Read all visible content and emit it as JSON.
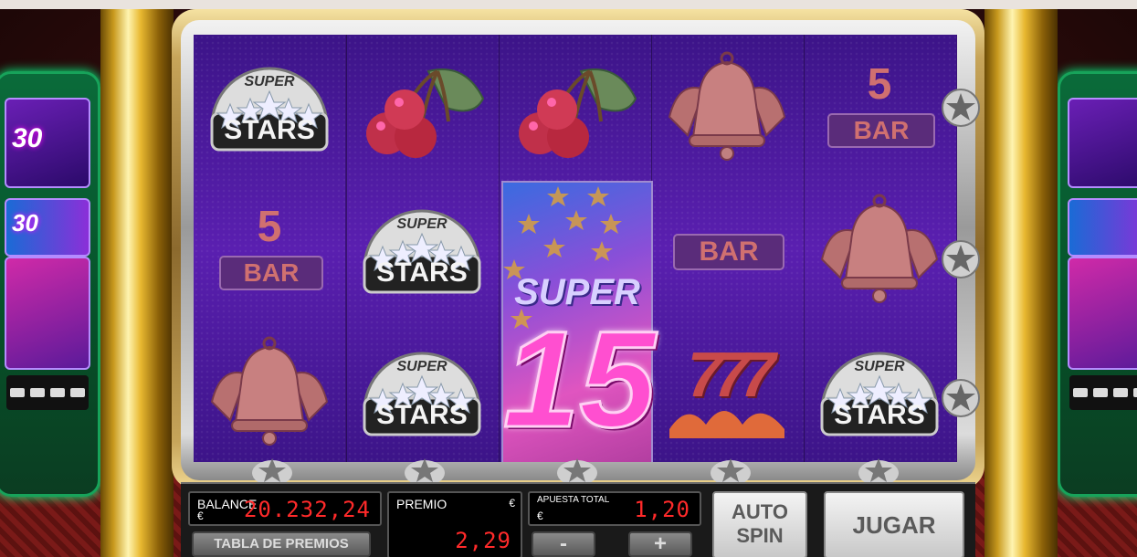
{
  "panel": {
    "balance_label": "BALANCE",
    "balance_currency": "€",
    "balance_value": "20.232,24",
    "prize_label": "PREMIO",
    "prize_currency": "€",
    "prize_value": "2,29",
    "bet_label": "APUESTA TOTAL",
    "bet_currency": "€",
    "bet_value": "1,20",
    "paytable_label": "TABLA DE PREMIOS",
    "minus_label": "-",
    "plus_label": "+",
    "autospin_line1": "AUTO",
    "autospin_line2": "SPIN",
    "play_label": "JUGAR"
  },
  "reels": [
    [
      "super-stars",
      "5-bar",
      "bell"
    ],
    [
      "cherries",
      "super-stars",
      "super-stars"
    ],
    [
      "cherries",
      "super-15-expanded",
      "super-15-expanded"
    ],
    [
      "bell",
      "bar",
      "sevens"
    ],
    [
      "5-bar",
      "bell",
      "super-stars"
    ]
  ],
  "symbol_text": {
    "super_stars_top": "SUPER",
    "super_stars_bottom": "STARS",
    "five_bar_number": "5",
    "bar_word": "BAR",
    "seven": "777",
    "super15_word": "SUPER",
    "super15_number": "15"
  },
  "colors": {
    "reel_bg": "#4a1a9a",
    "lcd_digits": "#ff2a2a",
    "gold": "#e8b830"
  }
}
